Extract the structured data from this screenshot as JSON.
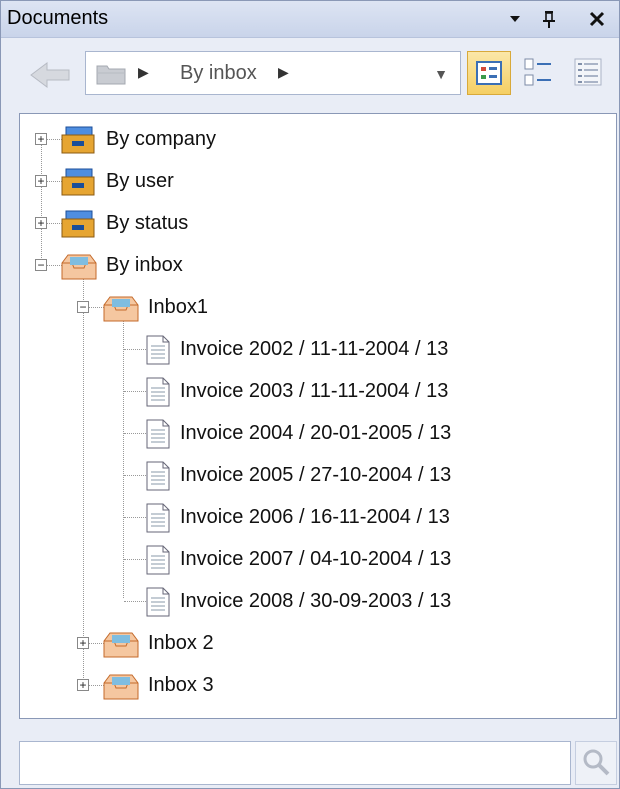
{
  "panel": {
    "title": "Documents",
    "title_buttons": [
      "dropdown-icon",
      "pin-icon",
      "close-icon"
    ]
  },
  "toolbar": {
    "breadcrumb": "By inbox",
    "views": [
      "large-icons-view-icon",
      "details-view-icon",
      "list-view-icon"
    ],
    "active_view": "large-icons-view-icon"
  },
  "tree": {
    "roots": [
      {
        "label": "By company",
        "expanded": false,
        "icon": "cabinet-icon"
      },
      {
        "label": "By user",
        "expanded": false,
        "icon": "cabinet-icon"
      },
      {
        "label": "By status",
        "expanded": false,
        "icon": "cabinet-icon"
      },
      {
        "label": "By inbox",
        "expanded": true,
        "icon": "inbox-icon"
      }
    ],
    "inboxes": [
      {
        "label": "Inbox1",
        "expanded": true
      },
      {
        "label": "Inbox 2",
        "expanded": false
      },
      {
        "label": "Inbox 3",
        "expanded": false
      }
    ],
    "documents": [
      "Invoice 2002 / 11-11-2004 / 13",
      "Invoice 2003 / 11-11-2004 / 13",
      "Invoice 2004 / 20-01-2005 / 13",
      "Invoice 2005 / 27-10-2004 / 13",
      "Invoice 2006 / 16-11-2004 / 13",
      "Invoice 2007 / 04-10-2004 / 13",
      "Invoice 2008 / 30-09-2003 / 13"
    ]
  },
  "search": {
    "value": "",
    "placeholder": ""
  }
}
